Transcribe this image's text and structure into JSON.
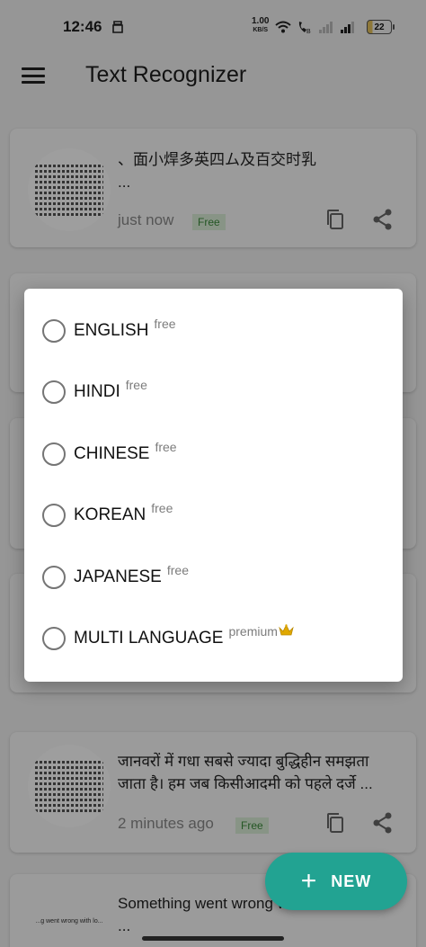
{
  "status_bar": {
    "time": "12:46",
    "net_speed": "1.00",
    "net_unit": "KB/S",
    "battery": "22"
  },
  "app_bar": {
    "title": "Text Recognizer"
  },
  "history": [
    {
      "text_line1": "、面小焊多英四ム及百交时乳",
      "text_line2": "...",
      "time": "just now",
      "badge": "Free"
    },
    {
      "text_line1": "जानवरों में गधा सबसे ज्यादा बुद्धिहीन समझता",
      "text_line2": "जाता है। हम जब किसीआदमी को पहले दर्जे ...",
      "time": "2 minutes ago",
      "badge": "Free"
    },
    {
      "text_line1": "Something went wrong with lo",
      "text_line2": "...",
      "thumb_caption": "...g went wrong with lo..."
    }
  ],
  "dialog": {
    "options": [
      {
        "label": "ENGLISH",
        "tag": "free"
      },
      {
        "label": "HINDI",
        "tag": "free"
      },
      {
        "label": "CHINESE",
        "tag": "free"
      },
      {
        "label": "KOREAN",
        "tag": "free"
      },
      {
        "label": "JAPANESE",
        "tag": "free"
      },
      {
        "label": "MULTI LANGUAGE",
        "tag": "premium",
        "icon": "crown-icon"
      }
    ]
  },
  "fab": {
    "label": "NEW"
  },
  "colors": {
    "accent": "#22a392",
    "free_badge_text": "#3a8c3a",
    "free_badge_bg": "#dcefd9",
    "crown": "#e0a800"
  }
}
